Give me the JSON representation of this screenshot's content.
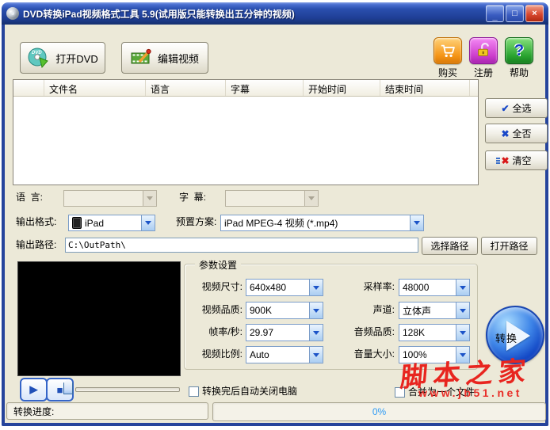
{
  "window": {
    "title": "DVD转换iPad视频格式工具 5.9(试用版只能转换出五分钟的视频)",
    "minimize": "_",
    "maximize": "□",
    "close": "×"
  },
  "toolbar": {
    "open_dvd": "打开DVD",
    "edit_video": "编辑视频",
    "buy": "购买",
    "register": "注册",
    "help": "帮助",
    "help_icon_glyph": "?"
  },
  "file_list": {
    "columns": [
      "文件名",
      "语言",
      "字幕",
      "开始时间",
      "结束时间"
    ],
    "rows": []
  },
  "list_actions": {
    "select_all": "全选",
    "select_none": "全否",
    "clear": "清空",
    "select_all_icon": "✔",
    "select_none_icon": "✖",
    "clear_icon": "✖"
  },
  "selectors": {
    "language_label": "语  言:",
    "language_value": "",
    "subtitle_label": "字  幕:",
    "subtitle_value": "",
    "output_format_label": "输出格式:",
    "output_format_value": "iPad",
    "preset_label": "预置方案:",
    "preset_value": "iPad MPEG-4 视频 (*.mp4)",
    "output_path_label": "输出路径:",
    "output_path_value": "C:\\OutPath\\",
    "choose_path": "选择路径",
    "open_path": "打开路径"
  },
  "params": {
    "group_title": "参数设置",
    "fields": [
      {
        "label": "视频尺寸:",
        "value": "640x480"
      },
      {
        "label": "视频品质:",
        "value": "900K"
      },
      {
        "label": "帧率/秒:",
        "value": "29.97"
      },
      {
        "label": "视频比例:",
        "value": "Auto"
      },
      {
        "label": "采样率:",
        "value": "48000"
      },
      {
        "label": "声道:",
        "value": "立体声"
      },
      {
        "label": "音频品质:",
        "value": "128K"
      },
      {
        "label": "音量大小:",
        "value": "100%"
      }
    ]
  },
  "player": {
    "play_icon": "▶",
    "stop_icon": "■"
  },
  "options": {
    "shutdown_after": "转换完后自动关闭电脑",
    "merge_files": "合并为一个文件"
  },
  "convert": {
    "label": "转换"
  },
  "status": {
    "progress_label": "转换进度:",
    "progress_value": "0%"
  },
  "watermark": {
    "title": "脚本之家",
    "url": "www.jb51.net"
  },
  "colors": {
    "titlebar_blue": "#2a4fae",
    "window_bg": "#ECE9D8",
    "border_blue": "#26449c",
    "combo_arrow_blue": "#1c54c8",
    "progress_text_blue": "#2e9bf5",
    "watermark_red": "#e8251f",
    "buy_orange": "#f59516",
    "register_magenta": "#cc3ecc",
    "help_green": "#2aa430",
    "convert_blue": "#0c3fc0"
  }
}
